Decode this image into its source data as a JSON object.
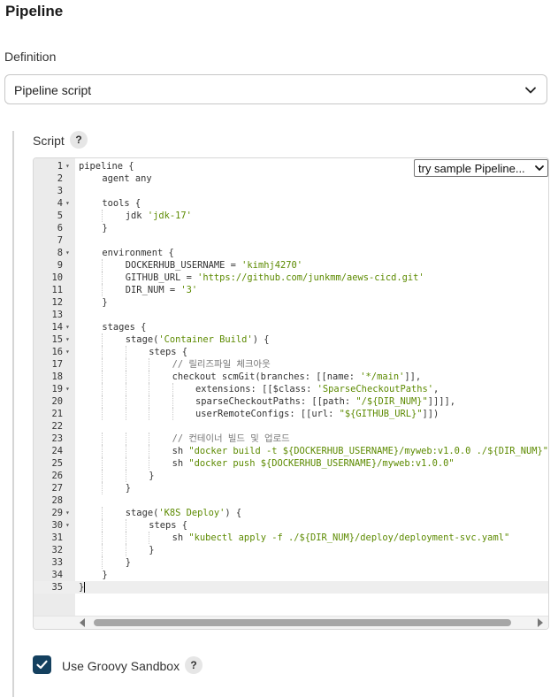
{
  "section": {
    "title": "Pipeline"
  },
  "definition": {
    "label": "Definition",
    "selected": "Pipeline script"
  },
  "script": {
    "label": "Script",
    "help": "?",
    "sample_select": "try sample Pipeline...",
    "lines": [
      {
        "n": "1",
        "fold": true,
        "indent": 0,
        "parts": [
          [
            "kw",
            "pipeline {"
          ]
        ]
      },
      {
        "n": "2",
        "fold": false,
        "indent": 1,
        "parts": [
          [
            "kw",
            "agent any"
          ]
        ]
      },
      {
        "n": "3",
        "fold": false,
        "indent": 0,
        "parts": []
      },
      {
        "n": "4",
        "fold": true,
        "indent": 1,
        "parts": [
          [
            "kw",
            "tools {"
          ]
        ]
      },
      {
        "n": "5",
        "fold": false,
        "indent": 2,
        "parts": [
          [
            "kw",
            "jdk "
          ],
          [
            "str",
            "'jdk-17'"
          ]
        ]
      },
      {
        "n": "6",
        "fold": false,
        "indent": 1,
        "parts": [
          [
            "kw",
            "}"
          ]
        ]
      },
      {
        "n": "7",
        "fold": false,
        "indent": 0,
        "parts": []
      },
      {
        "n": "8",
        "fold": true,
        "indent": 1,
        "parts": [
          [
            "kw",
            "environment {"
          ]
        ]
      },
      {
        "n": "9",
        "fold": false,
        "indent": 2,
        "parts": [
          [
            "kw",
            "DOCKERHUB_USERNAME = "
          ],
          [
            "str",
            "'kimhj4270'"
          ]
        ]
      },
      {
        "n": "10",
        "fold": false,
        "indent": 2,
        "parts": [
          [
            "kw",
            "GITHUB_URL = "
          ],
          [
            "str",
            "'https://github.com/junkmm/aews-cicd.git'"
          ]
        ]
      },
      {
        "n": "11",
        "fold": false,
        "indent": 2,
        "parts": [
          [
            "kw",
            "DIR_NUM = "
          ],
          [
            "str",
            "'3'"
          ]
        ]
      },
      {
        "n": "12",
        "fold": false,
        "indent": 1,
        "parts": [
          [
            "kw",
            "}"
          ]
        ]
      },
      {
        "n": "13",
        "fold": false,
        "indent": 0,
        "parts": []
      },
      {
        "n": "14",
        "fold": true,
        "indent": 1,
        "parts": [
          [
            "kw",
            "stages {"
          ]
        ]
      },
      {
        "n": "15",
        "fold": true,
        "indent": 2,
        "parts": [
          [
            "kw",
            "stage("
          ],
          [
            "str",
            "'Container Build'"
          ],
          [
            "kw",
            ") {"
          ]
        ]
      },
      {
        "n": "16",
        "fold": true,
        "indent": 3,
        "parts": [
          [
            "kw",
            "steps {"
          ]
        ]
      },
      {
        "n": "17",
        "fold": false,
        "indent": 4,
        "parts": [
          [
            "cmt",
            "// 릴리즈파일 체크아웃"
          ]
        ]
      },
      {
        "n": "18",
        "fold": false,
        "indent": 4,
        "parts": [
          [
            "kw",
            "checkout scmGit(branches: [[name: "
          ],
          [
            "str",
            "'*/main'"
          ],
          [
            "kw",
            "]],"
          ]
        ]
      },
      {
        "n": "19",
        "fold": true,
        "indent": 5,
        "parts": [
          [
            "kw",
            "extensions: [[$class: "
          ],
          [
            "str",
            "'SparseCheckoutPaths'"
          ],
          [
            "kw",
            ","
          ]
        ]
      },
      {
        "n": "20",
        "fold": false,
        "indent": 5,
        "parts": [
          [
            "kw",
            "sparseCheckoutPaths: [[path: "
          ],
          [
            "str",
            "\"/${DIR_NUM}\""
          ],
          [
            "kw",
            "]]]],"
          ]
        ]
      },
      {
        "n": "21",
        "fold": false,
        "indent": 5,
        "parts": [
          [
            "kw",
            "userRemoteConfigs: [[url: "
          ],
          [
            "str",
            "\"${GITHUB_URL}\""
          ],
          [
            "kw",
            "]])"
          ]
        ]
      },
      {
        "n": "22",
        "fold": false,
        "indent": 0,
        "parts": []
      },
      {
        "n": "23",
        "fold": false,
        "indent": 4,
        "parts": [
          [
            "cmt",
            "// 컨테이너 빌드 및 업로드"
          ]
        ]
      },
      {
        "n": "24",
        "fold": false,
        "indent": 4,
        "parts": [
          [
            "kw",
            "sh "
          ],
          [
            "str",
            "\"docker build -t ${DOCKERHUB_USERNAME}/myweb:v1.0.0 ./${DIR_NUM}\""
          ]
        ]
      },
      {
        "n": "25",
        "fold": false,
        "indent": 4,
        "parts": [
          [
            "kw",
            "sh "
          ],
          [
            "str",
            "\"docker push ${DOCKERHUB_USERNAME}/myweb:v1.0.0\""
          ]
        ]
      },
      {
        "n": "26",
        "fold": false,
        "indent": 3,
        "parts": [
          [
            "kw",
            "}"
          ]
        ]
      },
      {
        "n": "27",
        "fold": false,
        "indent": 2,
        "parts": [
          [
            "kw",
            "}"
          ]
        ]
      },
      {
        "n": "28",
        "fold": false,
        "indent": 0,
        "parts": []
      },
      {
        "n": "29",
        "fold": true,
        "indent": 2,
        "parts": [
          [
            "kw",
            "stage("
          ],
          [
            "str",
            "'K8S Deploy'"
          ],
          [
            "kw",
            ") {"
          ]
        ]
      },
      {
        "n": "30",
        "fold": true,
        "indent": 3,
        "parts": [
          [
            "kw",
            "steps {"
          ]
        ]
      },
      {
        "n": "31",
        "fold": false,
        "indent": 4,
        "parts": [
          [
            "kw",
            "sh "
          ],
          [
            "str",
            "\"kubectl apply -f ./${DIR_NUM}/deploy/deployment-svc.yaml\""
          ]
        ]
      },
      {
        "n": "32",
        "fold": false,
        "indent": 3,
        "parts": [
          [
            "kw",
            "}"
          ]
        ]
      },
      {
        "n": "33",
        "fold": false,
        "indent": 2,
        "parts": [
          [
            "kw",
            "}"
          ]
        ]
      },
      {
        "n": "34",
        "fold": false,
        "indent": 1,
        "parts": [
          [
            "kw",
            "}"
          ]
        ]
      },
      {
        "n": "35",
        "fold": false,
        "indent": 0,
        "active": true,
        "parts": [
          [
            "kw",
            "}"
          ]
        ]
      }
    ]
  },
  "sandbox": {
    "label": "Use Groovy Sandbox",
    "checked": true,
    "help": "?"
  },
  "colors": {
    "checkbox": "#14405f",
    "string": "#5c8a00",
    "comment": "#777777"
  }
}
